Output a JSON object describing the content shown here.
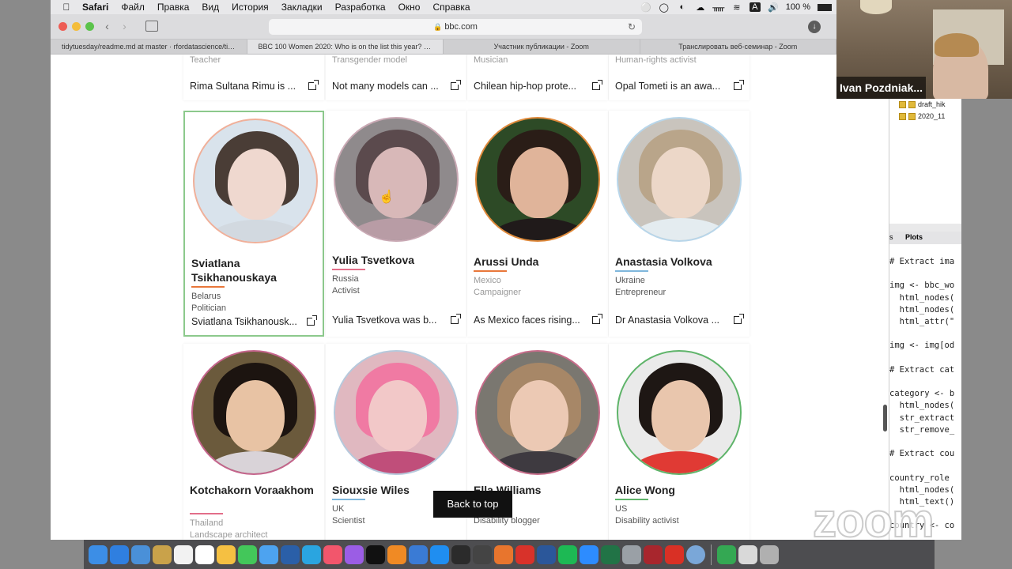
{
  "menubar": {
    "app": "Safari",
    "items": [
      "Файл",
      "Правка",
      "Вид",
      "История",
      "Закладки",
      "Разработка",
      "Окно",
      "Справка"
    ],
    "battery": "100 %"
  },
  "browser": {
    "url": "bbc.com",
    "tabs": [
      "tidytuesday/readme.md at master · rfordatascience/tidyt...",
      "BBC 100 Women 2020: Who is on the list this year? - BB...",
      "Участник публикации - Zoom",
      "Транслировать веб-семинар - Zoom"
    ],
    "active_tab": 1
  },
  "top_row": [
    {
      "role": "Teacher",
      "desc": "Rima Sultana Rimu is ..."
    },
    {
      "role": "Transgender model",
      "desc": "Not many models can ..."
    },
    {
      "role": "Musician",
      "desc": "Chilean hip-hop prote..."
    },
    {
      "role": "Human-rights activist",
      "desc": "Opal Tometi is an awa..."
    }
  ],
  "cards": [
    {
      "name": "Sviatlana Tsikhanouskaya",
      "country": "Belarus",
      "role": "Politician",
      "desc": "Sviatlana Tsikhanousk...",
      "bar": "#e8773a",
      "ring": "#f0b09a",
      "bg": "#d9e3ec",
      "skin": "#efd8cf",
      "hair": "#4a3d36",
      "cloth": "#d2d9e0",
      "selected": true,
      "faded": false
    },
    {
      "name": "Yulia Tsvetkova",
      "country": "Russia",
      "role": "Activist",
      "desc": "Yulia Tsvetkova was b...",
      "bar": "#e36e8a",
      "ring": "#c9a9b4",
      "bg": "#8f8a8c",
      "skin": "#d8b8b8",
      "hair": "#5b4a4d",
      "cloth": "#b89ca5",
      "selected": false,
      "faded": false
    },
    {
      "name": "Arussi Unda",
      "country": "Mexico",
      "role": "Campaigner",
      "desc": "As Mexico faces rising...",
      "bar": "#e8773a",
      "ring": "#e08a3c",
      "bg": "#2d4a26",
      "skin": "#e0b49a",
      "hair": "#2a1d17",
      "cloth": "#201a1a",
      "selected": false,
      "faded": true
    },
    {
      "name": "Anastasia Volkova",
      "country": "Ukraine",
      "role": "Entrepreneur",
      "desc": "Dr Anastasia Volkova ...",
      "bar": "#7fb7dc",
      "ring": "#b8d6ea",
      "bg": "#c9c4bd",
      "skin": "#ecd7c8",
      "hair": "#b9a58a",
      "cloth": "#e4ecf0",
      "selected": false,
      "faded": false
    },
    {
      "name": "Kotchakorn Voraakhom",
      "country": "Thailand",
      "role": "Landscape architect",
      "desc": "",
      "bar": "#e36e8a",
      "ring": "#c5648c",
      "bg": "#6b5a3c",
      "skin": "#e8c3a4",
      "hair": "#1c1410",
      "cloth": "#d9d3d8",
      "selected": false,
      "faded": true
    },
    {
      "name": "Siouxsie Wiles",
      "country": "UK",
      "role": "Scientist",
      "desc": "",
      "bar": "#7fb7dc",
      "ring": "#b6c9dc",
      "bg": "#e0b8c0",
      "skin": "#f2c8c8",
      "hair": "#f07aa3",
      "cloth": "#c04e7a",
      "selected": false,
      "faded": false
    },
    {
      "name": "Ella Williams",
      "country": "UK",
      "role": "Disability blogger",
      "desc": "",
      "bar": "#e36e8a",
      "ring": "#c76c8a",
      "bg": "#7a7770",
      "skin": "#ecc9b4",
      "hair": "#a78767",
      "cloth": "#3e3a40",
      "selected": false,
      "faded": false
    },
    {
      "name": "Alice Wong",
      "country": "US",
      "role": "Disability activist",
      "desc": "",
      "bar": "#5fb46a",
      "ring": "#5fb46a",
      "bg": "#eaeaea",
      "skin": "#e9c6ad",
      "hair": "#1e1714",
      "cloth": "#e03a34",
      "selected": false,
      "faded": false
    }
  ],
  "back_to_top": "Back to top",
  "webcam": {
    "name": "Ivan Pozdniak..."
  },
  "rstudio": {
    "files": [
      "draft_hik",
      "2020_11"
    ],
    "tabs": [
      "s",
      "Plots"
    ],
    "code": [
      "# Extract ima",
      "",
      "img <- bbc_wo",
      "  html_nodes(",
      "  html_nodes(",
      "  html_attr(\"",
      "",
      "img <- img[od",
      "",
      "# Extract cat",
      "",
      "category <- b",
      "  html_nodes(",
      "  str_extract",
      "  str_remove_",
      "",
      "# Extract cou",
      "",
      "country_role",
      "  html_nodes(",
      "  html_text()",
      "",
      "country <- co"
    ]
  },
  "watermark": "zoom",
  "dock": [
    "Finder",
    "Safari",
    "Preview",
    "Notes",
    "Calendar",
    "Reminders",
    "Photos",
    "Messages",
    "Mail",
    "R",
    "Telegram",
    "Music",
    "Podcasts",
    "TV",
    "Books",
    "Network",
    "App Store",
    "Terminal",
    "Activity",
    "Matlab",
    "Acrobat",
    "Word",
    "Spotify",
    "Zoom",
    "Excel",
    "Window",
    "Mendeley",
    "Record",
    "Preview2",
    "Chrome",
    "Files",
    "Trash"
  ]
}
